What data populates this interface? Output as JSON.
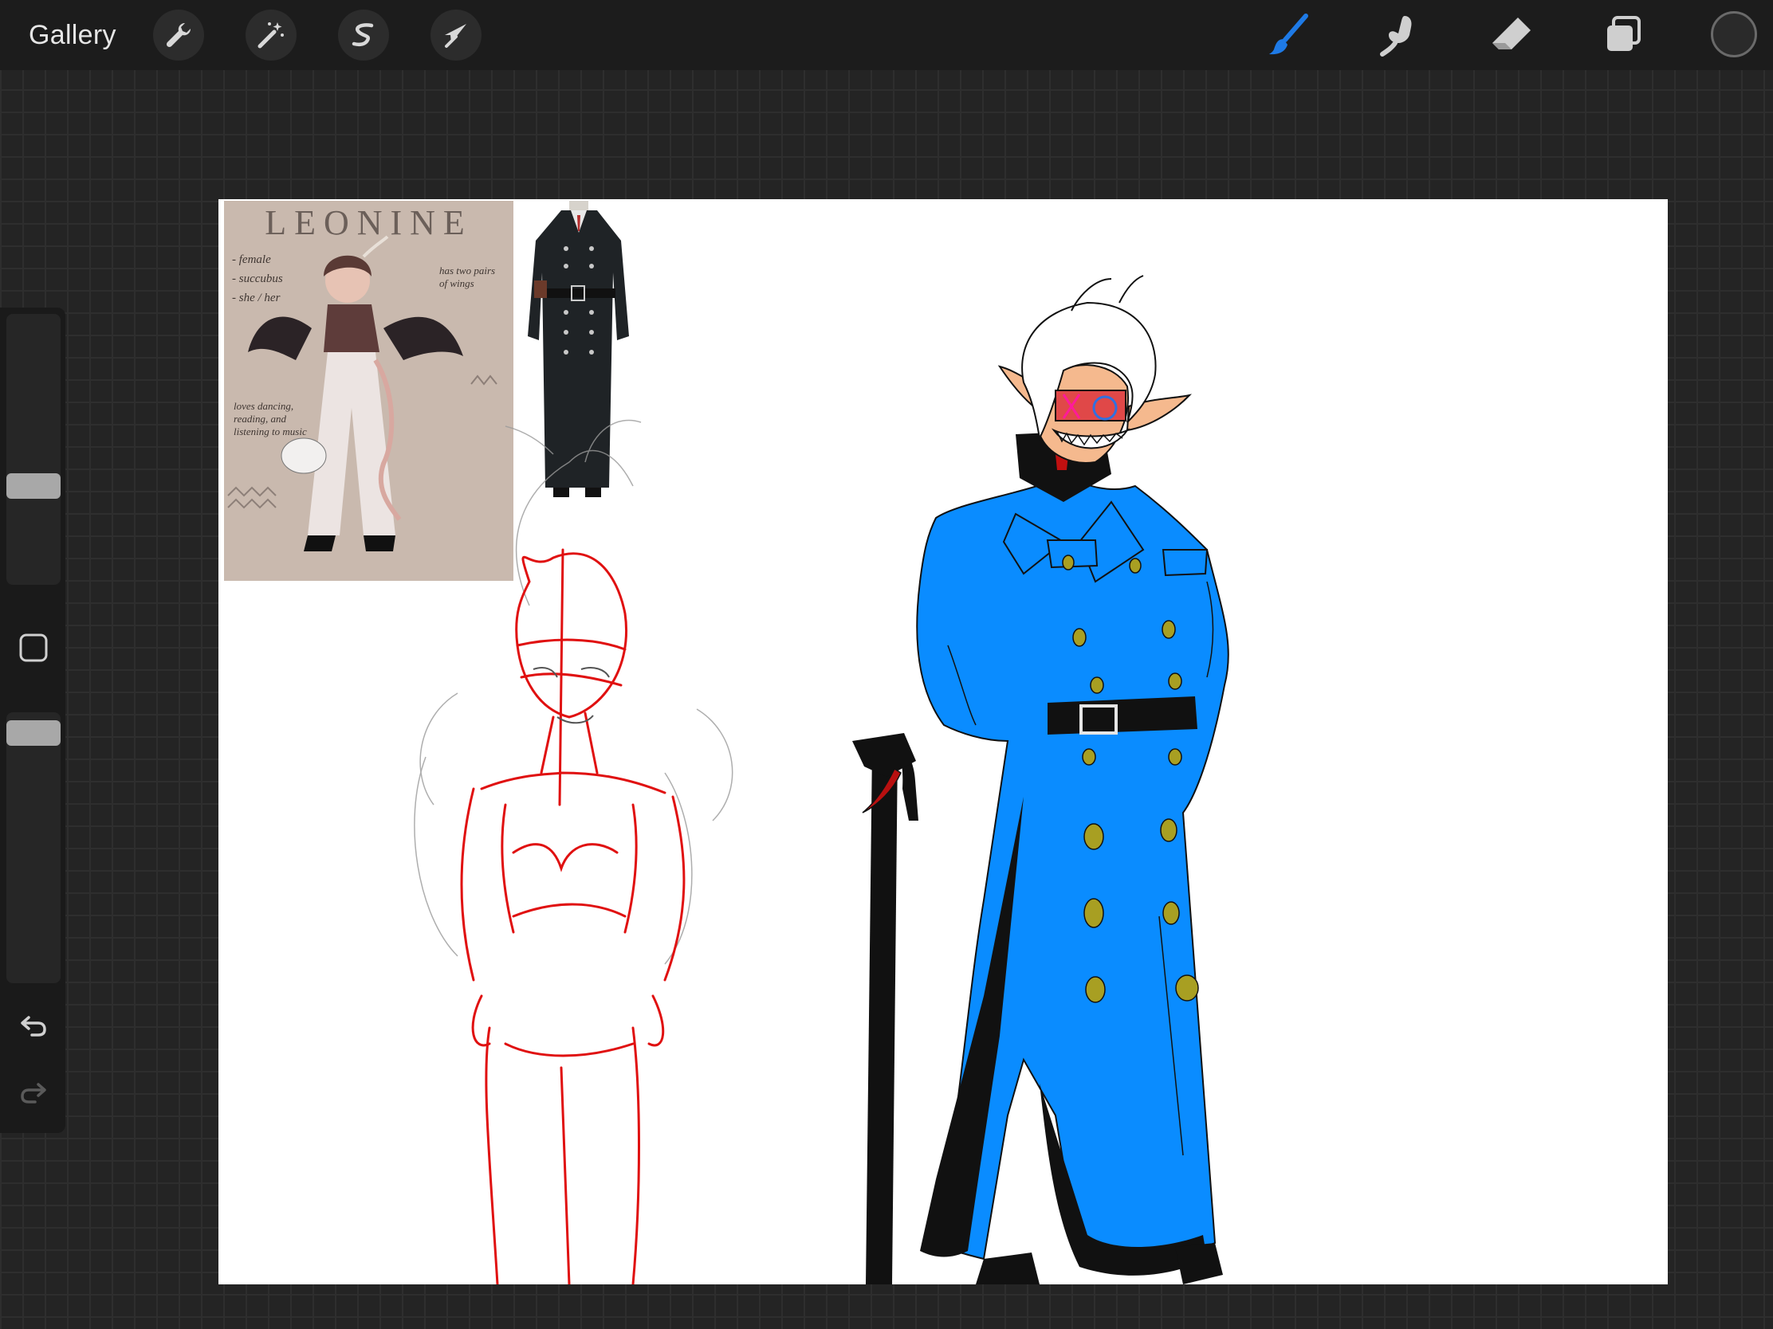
{
  "app": {
    "gallery_label": "Gallery"
  },
  "toolbar": {
    "left_tools": [
      {
        "id": "actions",
        "icon": "wrench-icon"
      },
      {
        "id": "adjustments",
        "icon": "magic-wand-icon"
      },
      {
        "id": "selection",
        "icon": "selection-s-icon"
      },
      {
        "id": "transform",
        "icon": "arrow-cursor-icon"
      }
    ],
    "right_tools": [
      {
        "id": "brush",
        "icon": "brush-icon",
        "active": true
      },
      {
        "id": "smudge",
        "icon": "smudge-finger-icon",
        "active": false
      },
      {
        "id": "eraser",
        "icon": "eraser-icon",
        "active": false
      },
      {
        "id": "layers",
        "icon": "layers-icon",
        "active": false
      }
    ],
    "active_color": "#1e7ae6",
    "color_well": "#2a2a2a"
  },
  "sidebar": {
    "brush_size": 0.35,
    "brush_opacity": 0.0,
    "modify_button_icon": "square-icon",
    "undo_icon": "undo-icon",
    "redo_icon": "redo-icon"
  },
  "canvas": {
    "background": "#ffffff",
    "coat_color": "#0a8cff",
    "sketch_color": "#e01010",
    "reference_sheet": {
      "title": "LEONINE",
      "notes": [
        "- female",
        "- succubus",
        "- she / her",
        "has two pairs of wings",
        "loves dancing, reading, and listening to music"
      ]
    }
  }
}
